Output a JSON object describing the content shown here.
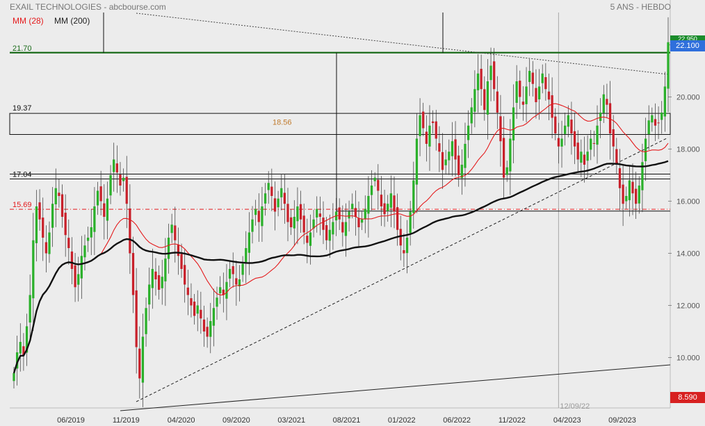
{
  "header": {
    "title": "EXAIL TECHNOLOGIES - abcbourse.com",
    "period": "5 ANS - HEBDO",
    "legend_ma28": "MM (28)",
    "legend_ma200": "MM (200)"
  },
  "tags": {
    "high": "22.950",
    "close": "22.100",
    "min": "8.590"
  },
  "colors": {
    "background": "#ececec",
    "up_candle": "#2ab02a",
    "down_candle": "#c8202a",
    "ma28": "#e41a1c",
    "ma200": "#111111",
    "resistance": "#1a6b1a",
    "close_tag": "#2f6fdc",
    "min_tag": "#d72020"
  },
  "chart_data": {
    "type": "candlestick",
    "title": "EXAIL TECHNOLOGIES",
    "x_ticks": [
      "06/2019",
      "11/2019",
      "04/2020",
      "09/2020",
      "03/2021",
      "08/2021",
      "01/2022",
      "06/2022",
      "11/2022",
      "04/2023",
      "09/2023"
    ],
    "y_ticks": [
      10,
      12,
      14,
      16,
      18,
      20,
      22
    ],
    "ylim": [
      8.2,
      22.9
    ],
    "grid": false,
    "legend_placement": "top-left",
    "horizontal_levels": [
      {
        "label": "21.70",
        "value": 21.7,
        "style": "solid-thick-green"
      },
      {
        "label": "19.37",
        "value": 19.37,
        "style": "solid"
      },
      {
        "label": "18.56",
        "value": 18.56,
        "style": "solid"
      },
      {
        "label": "17.04",
        "value": 17.04,
        "style": "solid"
      },
      {
        "label": "15.69",
        "value": 15.69,
        "style": "dash-dot-red"
      }
    ],
    "marker": {
      "label": "12/09/22",
      "date_index": 169
    },
    "weekly_close": [
      9.4,
      10.2,
      10.6,
      10.1,
      11.2,
      12.4,
      14.5,
      15.8,
      15.3,
      14.6,
      14.0,
      14.8,
      15.9,
      16.5,
      16.2,
      15.4,
      14.7,
      14.2,
      13.4,
      12.7,
      13.2,
      13.9,
      14.3,
      14.6,
      15.0,
      15.8,
      16.4,
      16.0,
      15.4,
      16.1,
      17.0,
      17.6,
      17.1,
      16.6,
      16.9,
      15.9,
      14.0,
      12.4,
      10.4,
      9.2,
      10.8,
      11.9,
      12.8,
      13.4,
      13.0,
      12.6,
      13.1,
      13.8,
      14.6,
      15.1,
      14.5,
      13.9,
      13.4,
      12.8,
      12.4,
      12.0,
      11.6,
      12.0,
      11.5,
      11.0,
      10.8,
      11.4,
      11.9,
      12.3,
      12.7,
      12.4,
      12.9,
      13.4,
      13.2,
      12.8,
      13.0,
      13.6,
      14.2,
      14.8,
      15.3,
      15.7,
      15.2,
      15.8,
      16.3,
      16.7,
      16.2,
      15.6,
      16.1,
      16.5,
      15.9,
      15.2,
      15.0,
      15.4,
      15.8,
      15.3,
      14.8,
      14.4,
      14.8,
      15.3,
      15.7,
      15.4,
      14.9,
      14.5,
      14.9,
      15.2,
      15.6,
      15.3,
      14.8,
      15.2,
      15.6,
      15.9,
      15.4,
      15.0,
      15.3,
      15.7,
      16.2,
      16.6,
      16.9,
      16.4,
      15.8,
      15.5,
      15.9,
      16.3,
      15.6,
      14.9,
      14.3,
      14.0,
      14.6,
      15.6,
      16.8,
      18.4,
      19.3,
      18.8,
      18.2,
      18.9,
      19.0,
      18.4,
      17.9,
      17.2,
      17.6,
      17.9,
      18.3,
      17.6,
      17.0,
      17.4,
      18.2,
      18.9,
      19.6,
      20.3,
      20.9,
      20.3,
      19.5,
      20.6,
      21.2,
      20.3,
      19.4,
      18.3,
      16.9,
      17.3,
      18.4,
      19.6,
      20.6,
      20.0,
      19.7,
      20.4,
      21.0,
      20.5,
      19.8,
      20.4,
      20.9,
      20.3,
      19.9,
      19.2,
      18.6,
      18.1,
      18.4,
      18.9,
      19.3,
      18.6,
      18.1,
      17.6,
      17.9,
      17.4,
      17.9,
      18.4,
      18.2,
      18.9,
      19.4,
      20.1,
      19.7,
      18.6,
      18.1,
      17.4,
      16.5,
      15.9,
      16.2,
      16.8,
      16.3,
      15.9,
      16.6,
      17.5,
      18.4,
      19.1,
      19.3,
      18.9,
      19.0,
      19.4,
      20.4,
      22.1
    ]
  }
}
